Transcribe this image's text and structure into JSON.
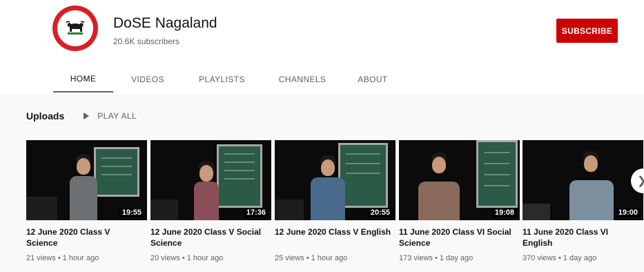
{
  "channel": {
    "name": "DoSE Nagaland",
    "subscribers": "20.6K subscribers",
    "subscribe_label": "SUBSCRIBE"
  },
  "tabs": [
    {
      "label": "HOME",
      "active": true
    },
    {
      "label": "VIDEOS",
      "active": false
    },
    {
      "label": "PLAYLISTS",
      "active": false
    },
    {
      "label": "CHANNELS",
      "active": false
    },
    {
      "label": "ABOUT",
      "active": false
    }
  ],
  "uploads": {
    "title": "Uploads",
    "play_all": "PLAY ALL"
  },
  "videos": [
    {
      "title": "12 June 2020 Class V Science",
      "duration": "19:55",
      "meta": "21 views • 1 hour ago"
    },
    {
      "title": "12 June 2020 Class V Social Science",
      "duration": "17:36",
      "meta": "20 views • 1 hour ago"
    },
    {
      "title": "12 June 2020 Class V English",
      "duration": "20:55",
      "meta": "25 views • 1 hour ago"
    },
    {
      "title": "11 June 2020 Class VI Social Science",
      "duration": "19:08",
      "meta": "173 views • 1 day ago"
    },
    {
      "title": "11 June 2020 Class VI English",
      "duration": "19:00",
      "meta": "370 views • 1 day ago"
    }
  ],
  "colors": {
    "brand_red": "#cc0000",
    "background": "#f9f9f9",
    "header": "#ffffff"
  }
}
